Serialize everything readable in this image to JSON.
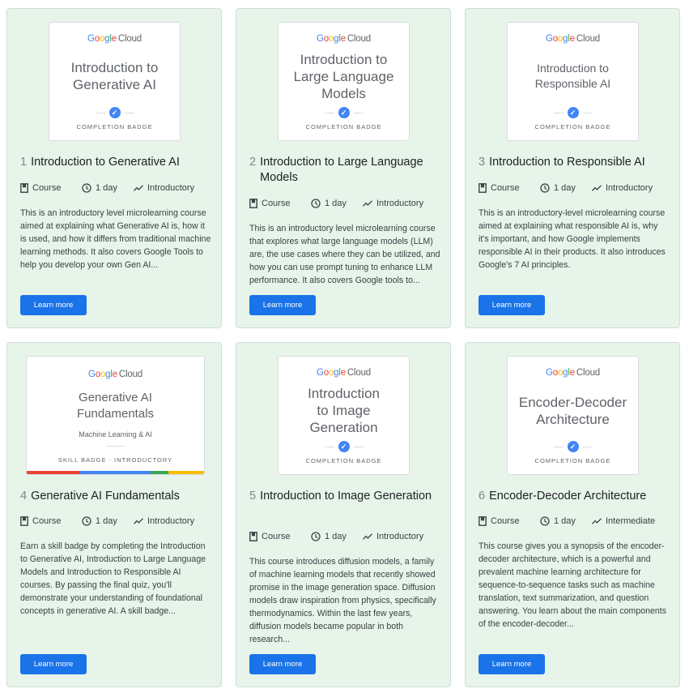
{
  "brand": {
    "google_letters": [
      "G",
      "o",
      "o",
      "g",
      "l",
      "e"
    ],
    "cloud": "Cloud",
    "colors": {
      "blue": "#4285f4",
      "red": "#ea4335",
      "yellow": "#fbbc05",
      "green": "#34a853",
      "button": "#1a73e8",
      "card_bg": "#e6f4ea"
    }
  },
  "cards": [
    {
      "number": "1",
      "title": "Introduction to Generative AI",
      "badge_title": "Introduction to Generative AI",
      "badge_caption": "COMPLETION BADGE",
      "type_icon": "book-icon",
      "type": "Course",
      "duration_icon": "clock-icon",
      "duration": "1 day",
      "level_icon": "trend-icon",
      "level": "Introductory",
      "description": "This is an introductory level microlearning course aimed at explaining what Generative AI is, how it is used, and how it differs from traditional machine learning methods. It also covers Google Tools to help you develop your own Gen AI...",
      "button": "Learn more"
    },
    {
      "number": "2",
      "title": "Introduction to Large Language Models",
      "badge_title": "Introduction to Large Language Models",
      "badge_caption": "COMPLETION BADGE",
      "type_icon": "book-icon",
      "type": "Course",
      "duration_icon": "clock-icon",
      "duration": "1 day",
      "level_icon": "trend-icon",
      "level": "Introductory",
      "description": "This is an introductory level microlearning course that explores what large language models (LLM) are, the use cases where they can be utilized, and how you can use prompt tuning to enhance LLM performance. It also covers Google tools to...",
      "button": "Learn more"
    },
    {
      "number": "3",
      "title": "Introduction to Responsible AI",
      "badge_title": "Introduction to Responsible AI",
      "badge_caption": "COMPLETION BADGE",
      "type_icon": "book-icon",
      "type": "Course",
      "duration_icon": "clock-icon",
      "duration": "1 day",
      "level_icon": "trend-icon",
      "level": "Introductory",
      "description": "This is an introductory-level microlearning course aimed at explaining what responsible AI is, why it's important, and how Google implements responsible AI in their products. It also introduces Google's 7 AI principles.",
      "button": "Learn more"
    },
    {
      "number": "4",
      "title": "Generative AI Fundamentals",
      "badge_title": "Generative AI Fundamentals",
      "badge_subtitle": "Machine Learning & AI",
      "badge_caption": "SKILL BADGE · INTRODUCTORY",
      "type_icon": "book-icon",
      "type": "Course",
      "duration_icon": "clock-icon",
      "duration": "1 day",
      "level_icon": "trend-icon",
      "level": "Introductory",
      "description": "Earn a skill badge by completing the Introduction to Generative AI, Introduction to Large Language Models and Introduction to Responsible AI courses. By passing the final quiz, you'll demonstrate your understanding of foundational concepts in generative AI. A skill badge...",
      "button": "Learn more"
    },
    {
      "number": "5",
      "title": "Introduction to Image Generation",
      "badge_title": "Introduction to Image Generation",
      "badge_caption": "COMPLETION BADGE",
      "type_icon": "book-icon",
      "type": "Course",
      "duration_icon": "clock-icon",
      "duration": "1 day",
      "level_icon": "trend-icon",
      "level": "Introductory",
      "description": "This course introduces diffusion models, a family of machine learning models that recently showed promise in the image generation space. Diffusion models draw inspiration from physics, specifically thermodynamics. Within the last few years, diffusion models became popular in both research...",
      "button": "Learn more"
    },
    {
      "number": "6",
      "title": "Encoder-Decoder Architecture",
      "badge_title": "Encoder-Decoder Architecture",
      "badge_caption": "COMPLETION BADGE",
      "type_icon": "book-icon",
      "type": "Course",
      "duration_icon": "clock-icon",
      "duration": "1 day",
      "level_icon": "trend-icon",
      "level": "Intermediate",
      "description": "This course gives you a synopsis of the encoder-decoder architecture, which is a powerful and prevalent machine learning architecture for sequence-to-sequence tasks such as machine translation, text summarization, and question answering. You learn about the main components of the encoder-decoder...",
      "button": "Learn more"
    }
  ]
}
